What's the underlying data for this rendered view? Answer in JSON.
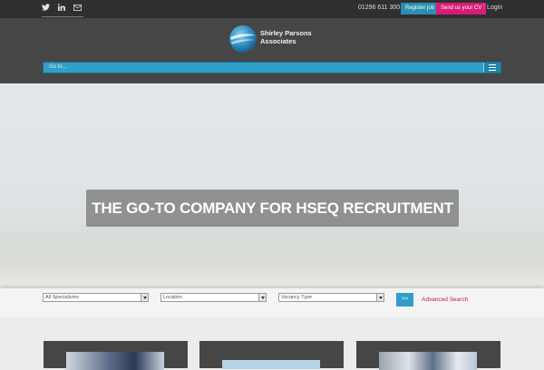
{
  "topbar": {
    "social_icons": [
      "twitter-icon",
      "linkedin-icon",
      "mail-icon"
    ],
    "phone": "01296 611 300",
    "register_label": "Register job",
    "cv_label": "Send us your CV",
    "separator": "|",
    "login_label": "Login"
  },
  "header": {
    "logo_line1": "Shirley Parsons",
    "logo_line2": "Associates",
    "nav_placeholder": "Go to..."
  },
  "hero": {
    "tagline": "THE GO-TO COMPANY FOR HSEQ RECRUITMENT"
  },
  "search": {
    "specialisms": "All Specialisms",
    "location": "Location",
    "vacancy_type": "Vacancy Type",
    "go_label": ">>",
    "advanced_label": "Advanced Search"
  },
  "colors": {
    "accent_blue": "#2f9fc9",
    "accent_pink": "#d81b77",
    "header_grey": "#464646"
  }
}
